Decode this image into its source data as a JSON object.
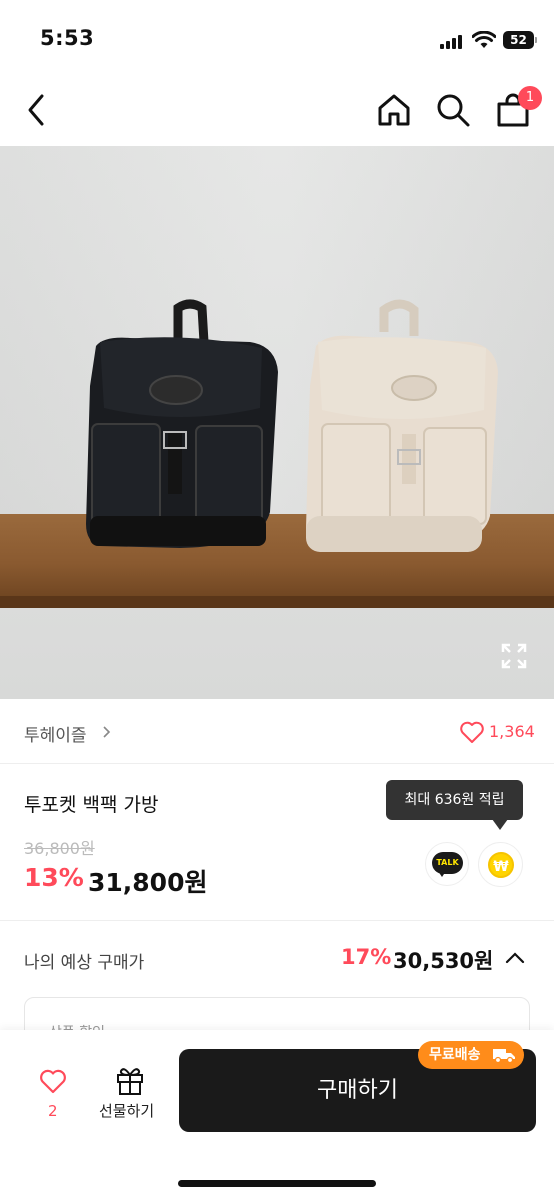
{
  "status_bar": {
    "time": "5:53",
    "battery": "52"
  },
  "header": {
    "cart_badge": "1"
  },
  "product_image": {
    "alt": "product-photo-backpacks"
  },
  "brand": {
    "name": "투헤이즐",
    "likes": "1,364"
  },
  "product": {
    "title": "투포켓 백팩 가방",
    "original_price": "36,800원",
    "discount_rate": "13%",
    "sale_price": "31,800원",
    "points_tooltip": "최대 636원 적립",
    "talk_label": "TALK",
    "point_symbol": "₩"
  },
  "expected": {
    "label": "나의 예상 구매가",
    "rate": "17%",
    "price": "30,530원",
    "coupon_label": "상품 할인"
  },
  "bottom_bar": {
    "wish_count": "2",
    "gift_label": "선물하기",
    "buy_label": "구매하기",
    "free_shipping": "무료배송"
  },
  "colors": {
    "accent": "#ff4a5a",
    "buy_button": "#1a1a1a",
    "free_shipping": "#ff8c1a"
  }
}
